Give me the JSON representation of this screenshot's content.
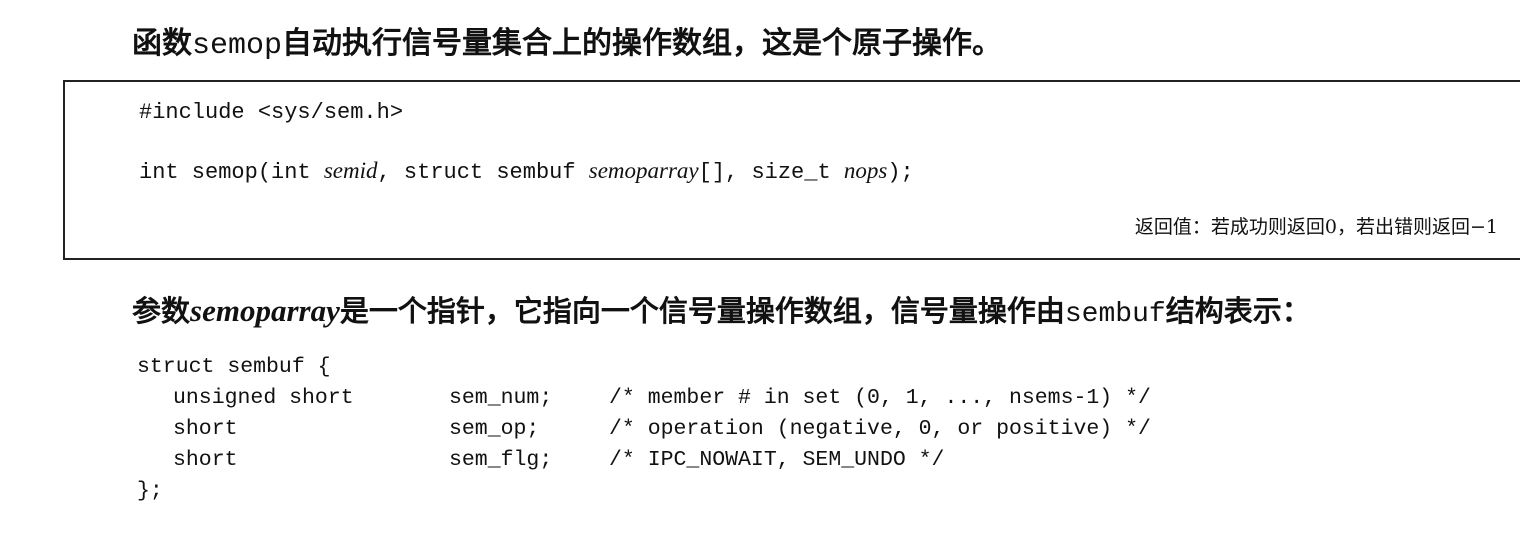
{
  "intro": {
    "before": "函数",
    "code": "semop",
    "after": "自动执行信号量集合上的操作数组，这是个原子操作。"
  },
  "prototype": {
    "include": "#include <sys/sem.h>",
    "sig_part1": "int semop(int ",
    "sig_arg1": "semid",
    "sig_part2": ", struct sembuf ",
    "sig_arg2": "semoparray",
    "sig_part3": "[], size_t ",
    "sig_arg3": "nops",
    "sig_part4": ");",
    "return_value": "返回值：若成功则返回0，若出错则返回−1"
  },
  "para2": {
    "before": "参数",
    "param": "semoparray",
    "middle": "是一个指针，它指向一个信号量操作数组，信号量操作由",
    "code": "sembuf",
    "after": "结构表示："
  },
  "struct_def": {
    "open": "struct sembuf {",
    "fields": [
      {
        "type": "unsigned short",
        "name": "sem_num;",
        "comment": "/* member # in set (0, 1, ..., nsems-1) */"
      },
      {
        "type": "short",
        "name": "sem_op;",
        "comment": "/* operation (negative, 0, or positive) */"
      },
      {
        "type": "short",
        "name": "sem_flg;",
        "comment": "/* IPC_NOWAIT, SEM_UNDO */"
      }
    ],
    "close": "};"
  }
}
